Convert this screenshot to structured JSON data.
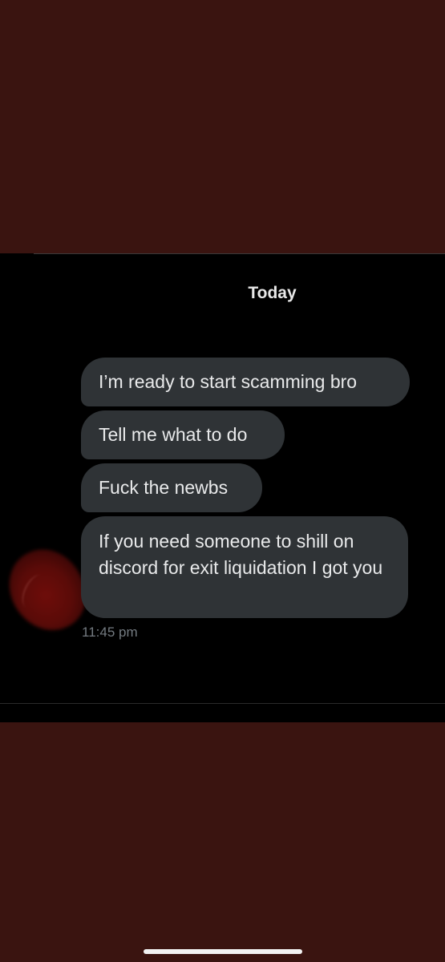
{
  "conversation": {
    "date_header": "Today",
    "messages": [
      {
        "text": "I’m ready to start scamming bro"
      },
      {
        "text": "Tell me what to do"
      },
      {
        "text": "Fuck the newbs"
      },
      {
        "text": "If you need someone to shill on discord for exit liquidation I got you"
      }
    ],
    "timestamp": "11:45 pm"
  },
  "colors": {
    "background_frame": "#3a1410",
    "chat_background": "#000000",
    "bubble": "#2f3336",
    "bubble_text": "#e9eaeb",
    "timestamp_text": "#737a80"
  },
  "icons": {
    "avatar": "redacted-avatar",
    "home_indicator": "home-indicator-bar"
  }
}
